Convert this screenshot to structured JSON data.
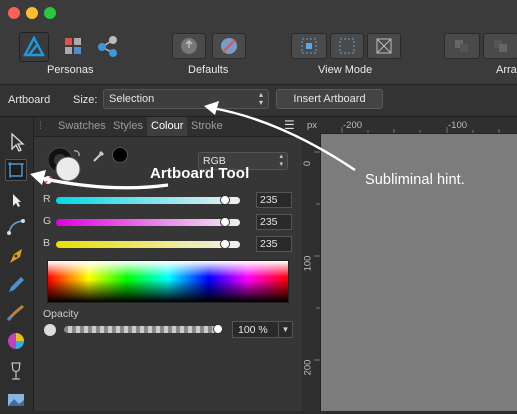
{
  "toolbar": {
    "personas_label": "Personas",
    "defaults_label": "Defaults",
    "view_mode_label": "View Mode",
    "arrange_label": "Arra"
  },
  "context": {
    "tool_name": "Artboard",
    "size_label": "Size:",
    "size_value": "Selection",
    "insert_artboard": "Insert Artboard"
  },
  "panel": {
    "tabs": [
      "Swatches",
      "Styles",
      "Colour",
      "Stroke"
    ],
    "active_tab": "Colour",
    "color_model": "RGB",
    "channels": [
      {
        "label": "R",
        "value": "235",
        "level": 0.92
      },
      {
        "label": "G",
        "value": "235",
        "level": 0.92
      },
      {
        "label": "B",
        "value": "235",
        "level": 0.92
      }
    ],
    "opacity_label": "Opacity",
    "opacity_value": "100 %"
  },
  "ruler": {
    "unit": "px",
    "top_ticks": [
      "-200",
      "-100"
    ],
    "left_ticks": [
      "0",
      "100",
      "200"
    ]
  },
  "annotations": {
    "artboard_tool": "Artboard Tool",
    "subliminal_hint": "Subliminal hint."
  },
  "colors": {
    "accent": "#1e9be0",
    "canvas": "#7c7c7c"
  }
}
